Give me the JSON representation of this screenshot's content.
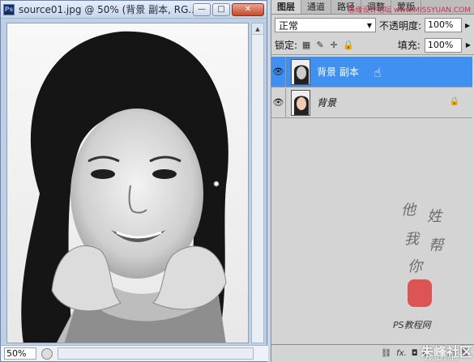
{
  "document": {
    "title": "source01.jpg @ 50% (背景 副本, RG...",
    "badge": "Ps",
    "zoom": "50%",
    "window_buttons": {
      "minimize": "—",
      "maximize": "□",
      "close": "✕"
    }
  },
  "panel": {
    "tabs": [
      "图层",
      "通道",
      "路径",
      "调整",
      "蒙版"
    ],
    "watermark": "思缘设计论坛 www.MISSYUAN.COM",
    "blend_mode": "正常",
    "opacity_label": "不透明度:",
    "opacity_value": "100%",
    "lock_label": "锁定:",
    "fill_label": "填充:",
    "fill_value": "100%",
    "layers": [
      {
        "name": "背景 副本",
        "selected": true
      },
      {
        "name": "背景",
        "selected": false,
        "locked": true
      }
    ],
    "seal_text": [
      "他",
      "姓",
      "我",
      "帮",
      "你"
    ],
    "ps_tutorial": "PS教程网",
    "footer_icons": [
      "link-icon",
      "fx-icon",
      "mask-icon",
      "adjust-icon",
      "folder-icon",
      "new-layer-icon",
      "trash-icon"
    ]
  },
  "branding": {
    "logo": "朱峰社区",
    "url": "ZF3D.com"
  },
  "colors": {
    "selection": "#3f90f0",
    "close_button": "#c44a2b"
  }
}
